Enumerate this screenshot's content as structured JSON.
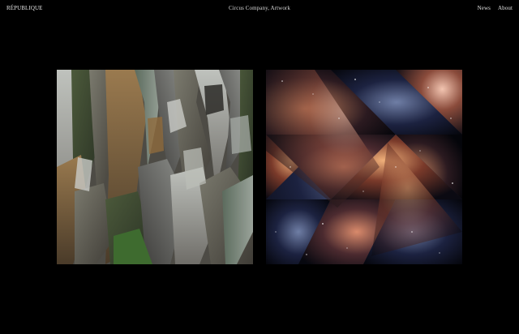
{
  "header": {
    "brand": "RÉPUBLIQUE",
    "title": "Circus Company, Artwork",
    "nav": [
      {
        "label": "News"
      },
      {
        "label": "About"
      }
    ]
  },
  "colors": {
    "background": "#000000",
    "text": "#dcdcdc"
  },
  "gallery": {
    "items": [
      {
        "subject": "rock-collage",
        "icon": "rock-mosaic-artwork"
      },
      {
        "subject": "nebula-collage",
        "icon": "nebula-triangles-artwork"
      }
    ]
  }
}
